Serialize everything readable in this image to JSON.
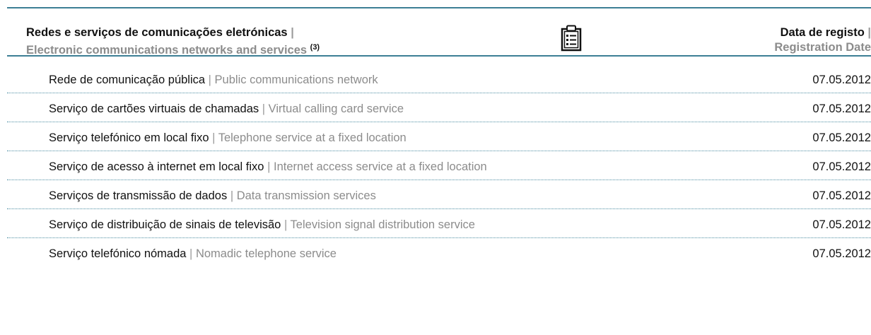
{
  "header": {
    "title_pt": "Redes e serviços de comunicações eletrónicas",
    "separator": "|",
    "title_en": "Electronic communications networks and services",
    "footnote": "(3)",
    "icon": "clipboard-icon",
    "date_pt": "Data de registo",
    "date_en": "Registration Date"
  },
  "colors": {
    "rule": "#3d7f95",
    "dotted_rule": "#4e8ea3",
    "primary_text": "#111111",
    "secondary_text": "#8c8c8c"
  },
  "rows": [
    {
      "pt": "Rede de comunicação pública",
      "sep": "|",
      "en": "Public communications network",
      "date": "07.05.2012"
    },
    {
      "pt": "Serviço de cartões virtuais de chamadas",
      "sep": "|",
      "en": "Virtual calling card service",
      "date": "07.05.2012"
    },
    {
      "pt": "Serviço telefónico em local fixo",
      "sep": "|",
      "en": "Telephone service at a fixed location",
      "date": "07.05.2012"
    },
    {
      "pt": "Serviço de acesso à internet em local fixo",
      "sep": "|",
      "en": "Internet access service at a fixed location",
      "date": "07.05.2012"
    },
    {
      "pt": "Serviços de transmissão de dados",
      "sep": "|",
      "en": "Data transmission services",
      "date": "07.05.2012"
    },
    {
      "pt": "Serviço de distribuição de sinais de televisão",
      "sep": "|",
      "en": "Television signal distribution service",
      "date": "07.05.2012"
    },
    {
      "pt": "Serviço telefónico nómada",
      "sep": "|",
      "en": "Nomadic telephone service",
      "date": "07.05.2012"
    }
  ]
}
